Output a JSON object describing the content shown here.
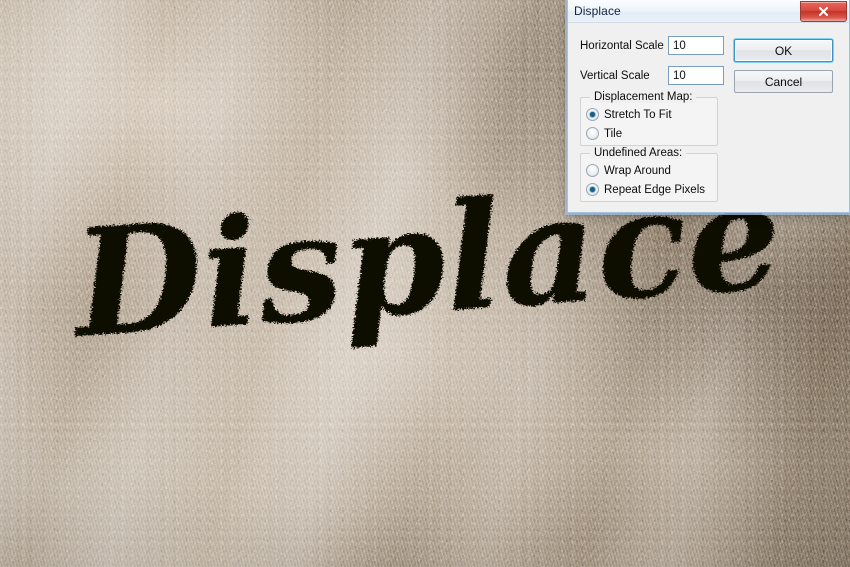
{
  "canvas": {
    "artwork_text": "Displace",
    "artwork_color": "#0a0806",
    "background_description": "fuzzy beige towel fabric texture",
    "background_colors": [
      "#c9bdad",
      "#b5a796",
      "#9c8d7c",
      "#ddd3c6"
    ]
  },
  "dialog": {
    "title": "Displace",
    "close_label": "x",
    "fields": [
      {
        "label": "Horizontal Scale",
        "value": "10"
      },
      {
        "label": "Vertical Scale",
        "value": "10"
      }
    ],
    "buttons": {
      "ok": "OK",
      "cancel": "Cancel"
    },
    "groups": [
      {
        "caption": "Displacement Map:",
        "options": [
          {
            "label": "Stretch To Fit",
            "selected": true
          },
          {
            "label": "Tile",
            "selected": false
          }
        ]
      },
      {
        "caption": "Undefined Areas:",
        "options": [
          {
            "label": "Wrap Around",
            "selected": false
          },
          {
            "label": "Repeat Edge Pixels",
            "selected": true
          }
        ]
      }
    ],
    "accent_color": "#7fd3f4",
    "close_color": "#c23326"
  }
}
